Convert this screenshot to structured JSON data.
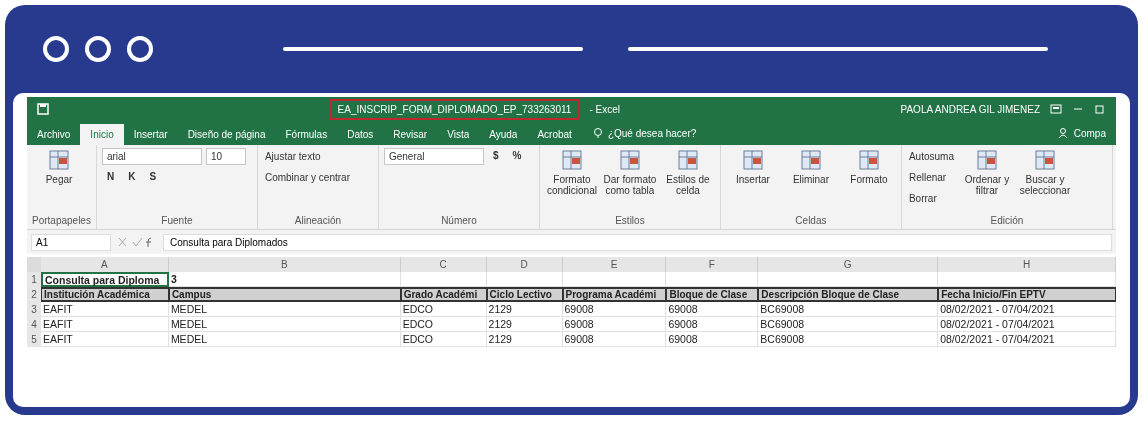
{
  "window": {
    "filename": "EA_INSCRIP_FORM_DIPLOMADO_EP_733263011",
    "app": "- Excel",
    "user": "PAOLA ANDREA GIL JIMENEZ"
  },
  "tabs": [
    {
      "label": "Archivo",
      "selected": false
    },
    {
      "label": "Inicio",
      "selected": true
    },
    {
      "label": "Insertar",
      "selected": false
    },
    {
      "label": "Diseño de página",
      "selected": false
    },
    {
      "label": "Fórmulas",
      "selected": false
    },
    {
      "label": "Datos",
      "selected": false
    },
    {
      "label": "Revisar",
      "selected": false
    },
    {
      "label": "Vista",
      "selected": false
    },
    {
      "label": "Ayuda",
      "selected": false
    },
    {
      "label": "Acrobat",
      "selected": false
    }
  ],
  "tell_me": "¿Qué desea hacer?",
  "share": "Compa",
  "ribbon": [
    {
      "label": "Portapapeles",
      "items": [
        {
          "kind": "large",
          "label": "Pegar"
        }
      ]
    },
    {
      "label": "Fuente",
      "items": [
        {
          "kind": "field",
          "label": "arial"
        },
        {
          "kind": "field",
          "label": "10"
        },
        {
          "kind": "letter",
          "label": "N"
        },
        {
          "kind": "letter",
          "label": "K"
        },
        {
          "kind": "letter",
          "label": "S"
        }
      ]
    },
    {
      "label": "Alineación",
      "items": [
        {
          "kind": "small",
          "label": "Ajustar texto"
        },
        {
          "kind": "small",
          "label": "Combinar y centrar"
        }
      ]
    },
    {
      "label": "Número",
      "items": [
        {
          "kind": "field",
          "label": "General"
        },
        {
          "kind": "letter",
          "label": "$"
        },
        {
          "kind": "letter",
          "label": "%"
        }
      ]
    },
    {
      "label": "Estilos",
      "items": [
        {
          "kind": "large",
          "label": "Formato condicional"
        },
        {
          "kind": "large",
          "label": "Dar formato como tabla"
        },
        {
          "kind": "large",
          "label": "Estilos de celda"
        }
      ]
    },
    {
      "label": "Celdas",
      "items": [
        {
          "kind": "large",
          "label": "Insertar"
        },
        {
          "kind": "large",
          "label": "Eliminar"
        },
        {
          "kind": "large",
          "label": "Formato"
        }
      ]
    },
    {
      "label": "Edición",
      "items": [
        {
          "kind": "small",
          "label": "Autosuma"
        },
        {
          "kind": "small",
          "label": "Rellenar"
        },
        {
          "kind": "small",
          "label": "Borrar"
        },
        {
          "kind": "large",
          "label": "Ordenar y filtrar"
        },
        {
          "kind": "large",
          "label": "Buscar y seleccionar"
        }
      ]
    }
  ],
  "formula_bar": {
    "cell": "A1",
    "value": "Consulta para Diplomados"
  },
  "sheet": {
    "columns": [
      "A",
      "B",
      "C",
      "D",
      "E",
      "F",
      "G",
      "H"
    ],
    "rows": [
      {
        "number": "1",
        "kind": "title",
        "cells": [
          "Consulta para Diploma",
          "3",
          "",
          "",
          "",
          "",
          "",
          ""
        ]
      },
      {
        "number": "2",
        "kind": "header",
        "cells": [
          "Institución Académica",
          "Campus",
          "Grado Académi",
          "Ciclo Lectivo",
          "Programa Académi",
          "Bloque de Clase",
          "Descripción Bloque de Clase",
          "Fecha Inicio/Fin EPTV"
        ]
      },
      {
        "number": "3",
        "kind": "data",
        "cells": [
          "EAFIT",
          "MEDEL",
          "EDCO",
          "2129",
          "69008",
          "69008",
          "BC69008",
          "08/02/2021 - 07/04/2021"
        ]
      },
      {
        "number": "4",
        "kind": "data",
        "cells": [
          "EAFIT",
          "MEDEL",
          "EDCO",
          "2129",
          "69008",
          "69008",
          "BC69008",
          "08/02/2021 - 07/04/2021"
        ]
      },
      {
        "number": "5",
        "kind": "data",
        "cells": [
          "EAFIT",
          "MEDEL",
          "EDCO",
          "2129",
          "69008",
          "69008",
          "BC69008",
          "08/02/2021 - 07/04/2021"
        ]
      }
    ]
  }
}
